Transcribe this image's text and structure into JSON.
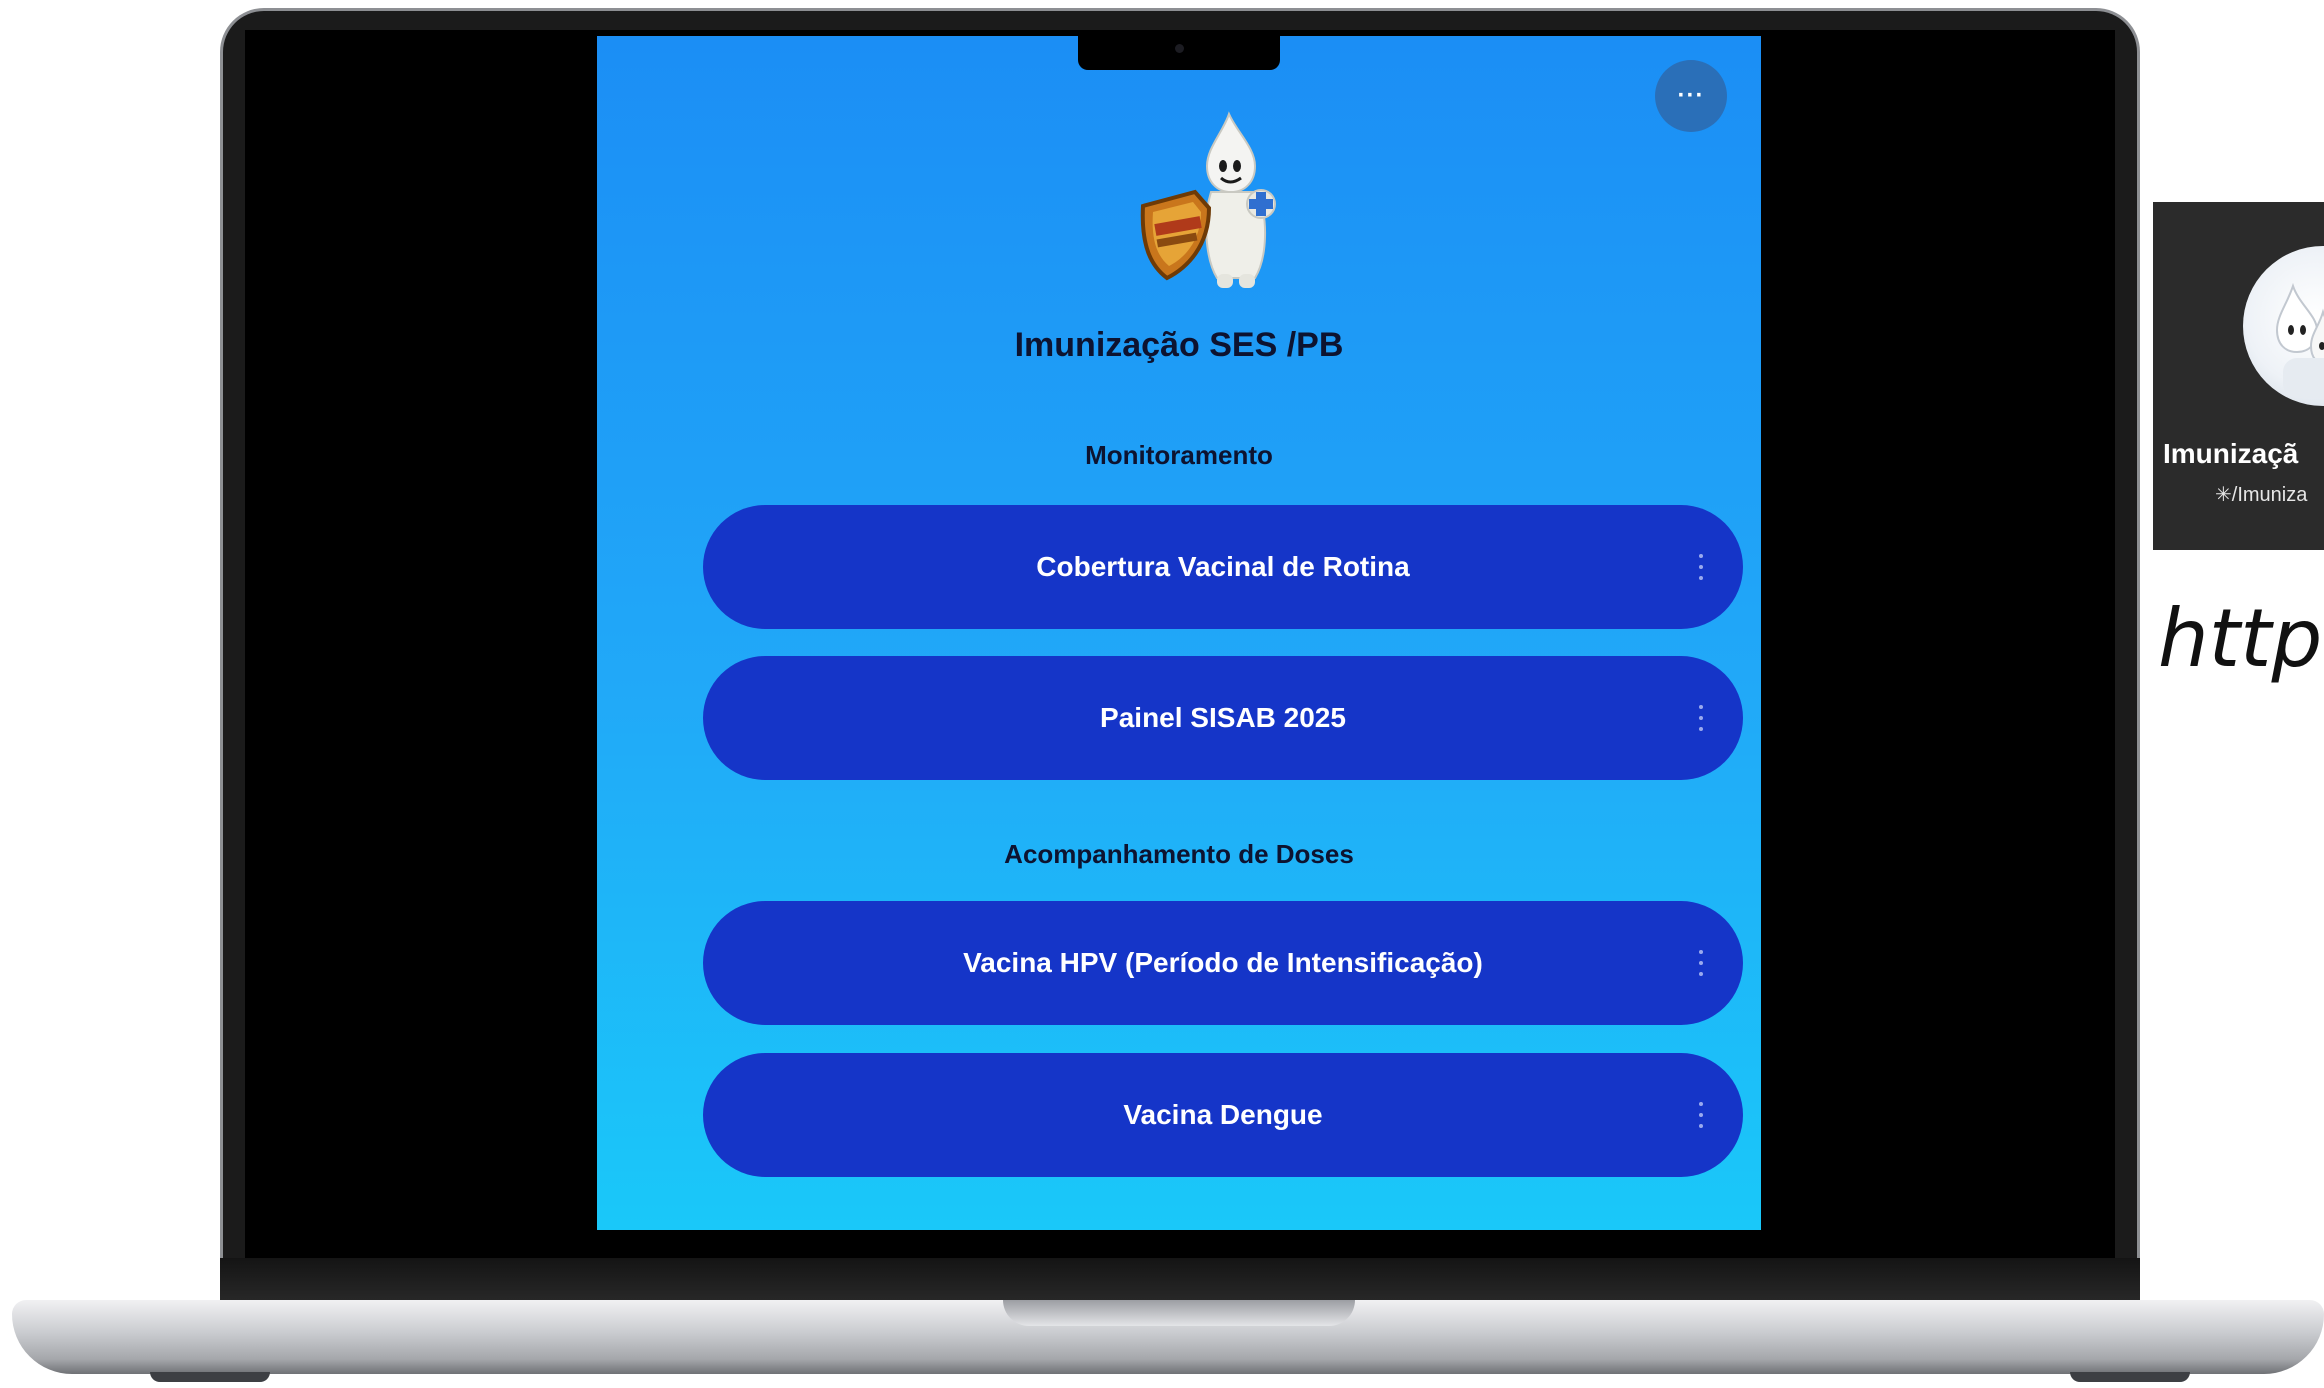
{
  "profile": {
    "title": "Imunização SES /PB",
    "more_label": "···"
  },
  "sections": [
    {
      "heading": "Monitoramento",
      "links": [
        {
          "label": "Cobertura Vacinal de Rotina"
        },
        {
          "label": "Painel SISAB 2025"
        }
      ]
    },
    {
      "heading": "Acompanhamento de Doses",
      "links": [
        {
          "label": "Vacina HPV (Período de Intensificação)"
        },
        {
          "label": "Vacina Dengue"
        }
      ]
    }
  ],
  "side_card": {
    "name": "Imunizaçã",
    "handle": "✳/Imuniza",
    "url": "http:"
  },
  "colors": {
    "page_gradient_top": "#1b8ef5",
    "page_gradient_bottom": "#1ac8f9",
    "button_bg": "#1535c8",
    "button_text": "#ffffff",
    "heading_text": "#0d1330"
  },
  "icons": {
    "more": "more-dots-icon",
    "link_menu": "kebab-menu-icon",
    "mascot": "mascot-zegotinha-icon"
  }
}
